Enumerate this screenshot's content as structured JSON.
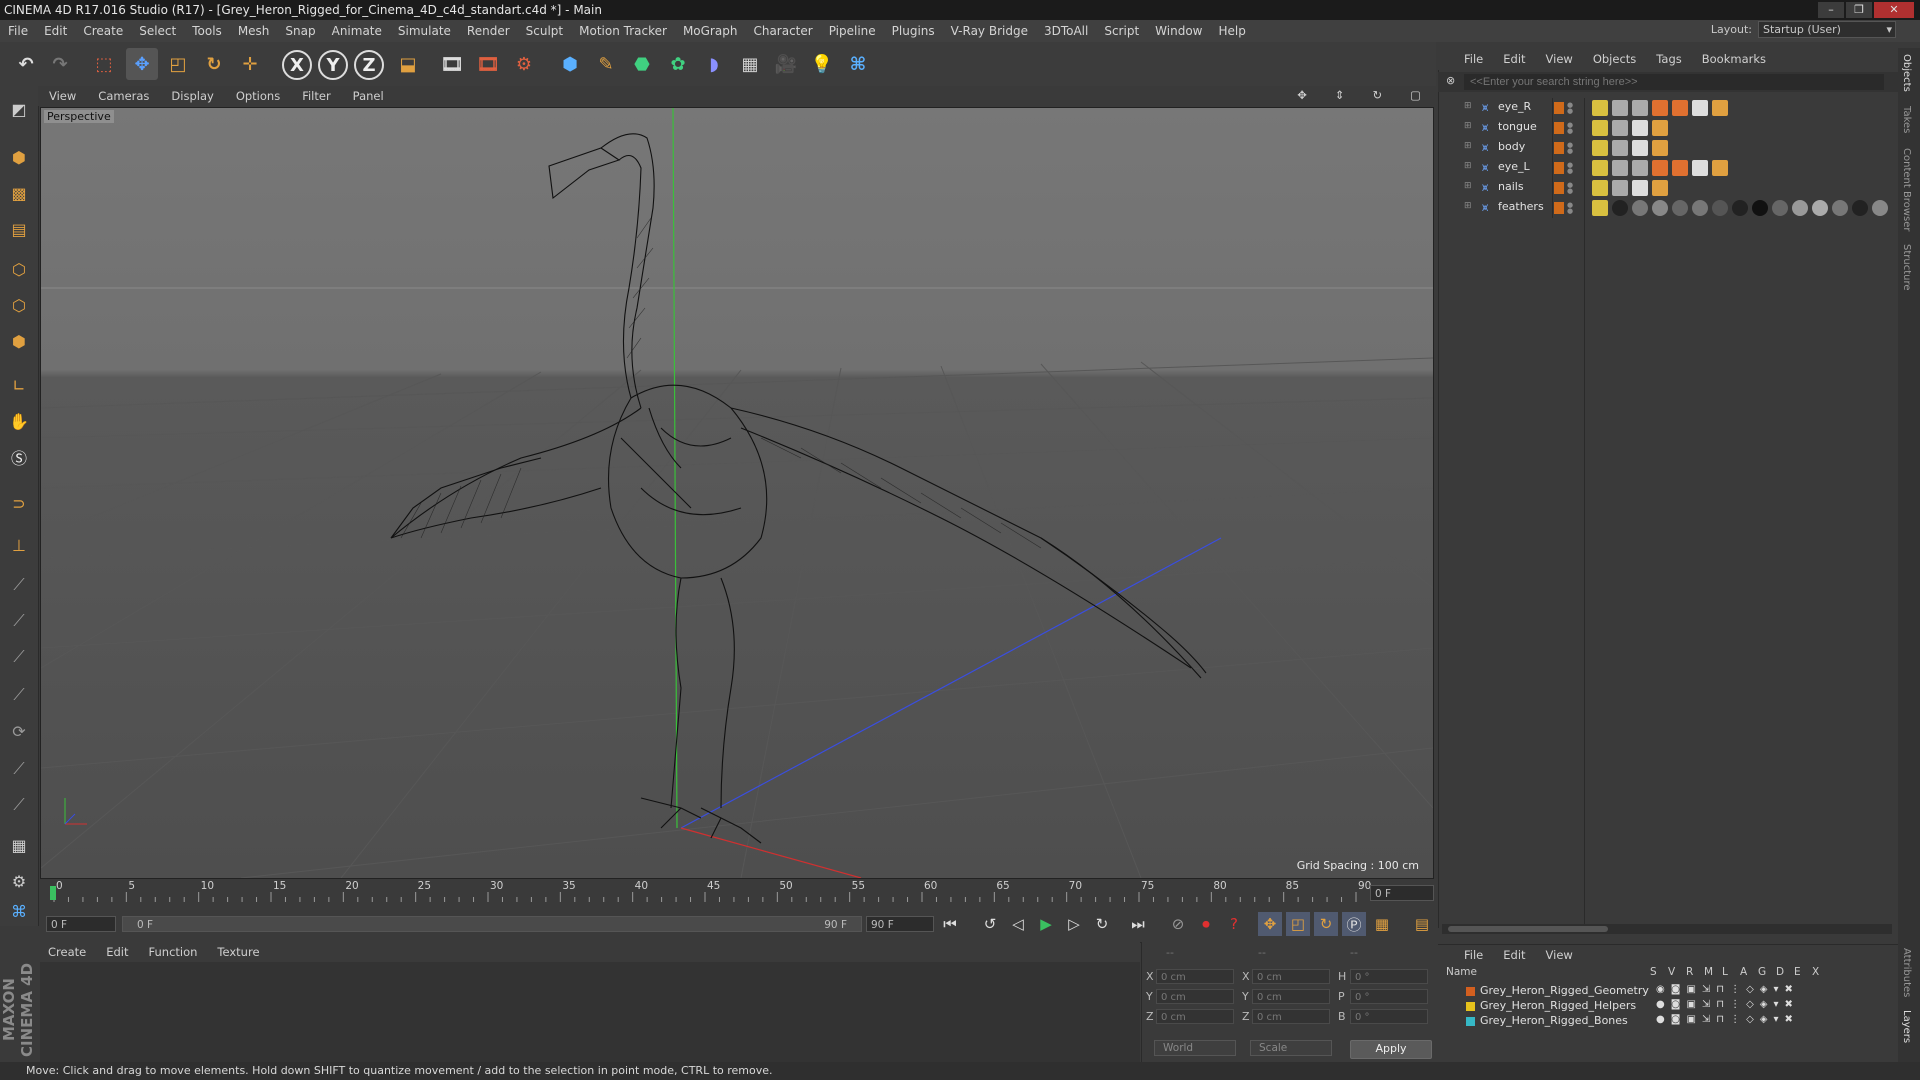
{
  "window": {
    "title": "CINEMA 4D R17.016 Studio (R17) - [Grey_Heron_Rigged_for_Cinema_4D_c4d_standart.c4d *] - Main",
    "controls": [
      "–",
      "❐",
      "✕"
    ]
  },
  "menubar": [
    "File",
    "Edit",
    "Create",
    "Select",
    "Tools",
    "Mesh",
    "Snap",
    "Animate",
    "Simulate",
    "Render",
    "Sculpt",
    "Motion Tracker",
    "MoGraph",
    "Character",
    "Pipeline",
    "Plugins",
    "V-Ray Bridge",
    "3DToAll",
    "Script",
    "Window",
    "Help"
  ],
  "layout": {
    "label": "Layout:",
    "value": "Startup (User)"
  },
  "toolbar": {
    "x": "X",
    "y": "Y",
    "z": "Z"
  },
  "viewport": {
    "menu": [
      "View",
      "Cameras",
      "Display",
      "Options",
      "Filter",
      "Panel"
    ],
    "label": "Perspective",
    "grid_spacing": "Grid Spacing : 100 cm"
  },
  "timeline": {
    "ticks": [
      "0",
      "5",
      "10",
      "15",
      "20",
      "25",
      "30",
      "35",
      "40",
      "45",
      "50",
      "55",
      "60",
      "65",
      "70",
      "75",
      "80",
      "85",
      "90"
    ],
    "current_frame": "0 F",
    "start_field": "0 F",
    "slider_start": "0 F",
    "slider_end": "90 F",
    "end_field": "90 F"
  },
  "material_menu": [
    "Create",
    "Edit",
    "Function",
    "Texture"
  ],
  "coords": {
    "header": [
      "--",
      "--",
      "--"
    ],
    "rows": [
      {
        "a": "X",
        "av": "0 cm",
        "b": "X",
        "bv": "0 cm",
        "c": "H",
        "cv": "0 °"
      },
      {
        "a": "Y",
        "av": "0 cm",
        "b": "Y",
        "bv": "0 cm",
        "c": "P",
        "cv": "0 °"
      },
      {
        "a": "Z",
        "av": "0 cm",
        "b": "Z",
        "bv": "0 cm",
        "c": "B",
        "cv": "0 °"
      }
    ],
    "world": "World",
    "scale": "Scale",
    "apply": "Apply"
  },
  "objects": {
    "menu": [
      "File",
      "Edit",
      "View",
      "Objects",
      "Tags",
      "Bookmarks"
    ],
    "search_placeholder": "<<Enter your search string here>>",
    "items": [
      {
        "name": "eye_R"
      },
      {
        "name": "tongue"
      },
      {
        "name": "body"
      },
      {
        "name": "eye_L"
      },
      {
        "name": "nails"
      },
      {
        "name": "feathers"
      }
    ]
  },
  "layers": {
    "menu": [
      "File",
      "Edit",
      "View"
    ],
    "columns": {
      "name": "Name",
      "flags": [
        "S",
        "V",
        "R",
        "M",
        "L",
        "A",
        "G",
        "D",
        "E",
        "X"
      ]
    },
    "items": [
      {
        "name": "Grey_Heron_Rigged_Geometry",
        "color": "#d35f1f"
      },
      {
        "name": "Grey_Heron_Rigged_Helpers",
        "color": "#e6c21c"
      },
      {
        "name": "Grey_Heron_Rigged_Bones",
        "color": "#36b8c6"
      }
    ]
  },
  "side_tabs": [
    "Objects",
    "Takes",
    "Content Browser",
    "Structure",
    "Attributes",
    "Layers"
  ],
  "brand": "MAXON CINEMA 4D",
  "status": "Move: Click and drag to move elements. Hold down SHIFT to quantize movement / add to the selection in point mode, CTRL to remove.",
  "colors": {
    "accent": "#e0a040",
    "selection": "#d35f1f",
    "axis_x": "#d03030",
    "axis_y": "#30c030",
    "axis_z": "#3050e0"
  }
}
